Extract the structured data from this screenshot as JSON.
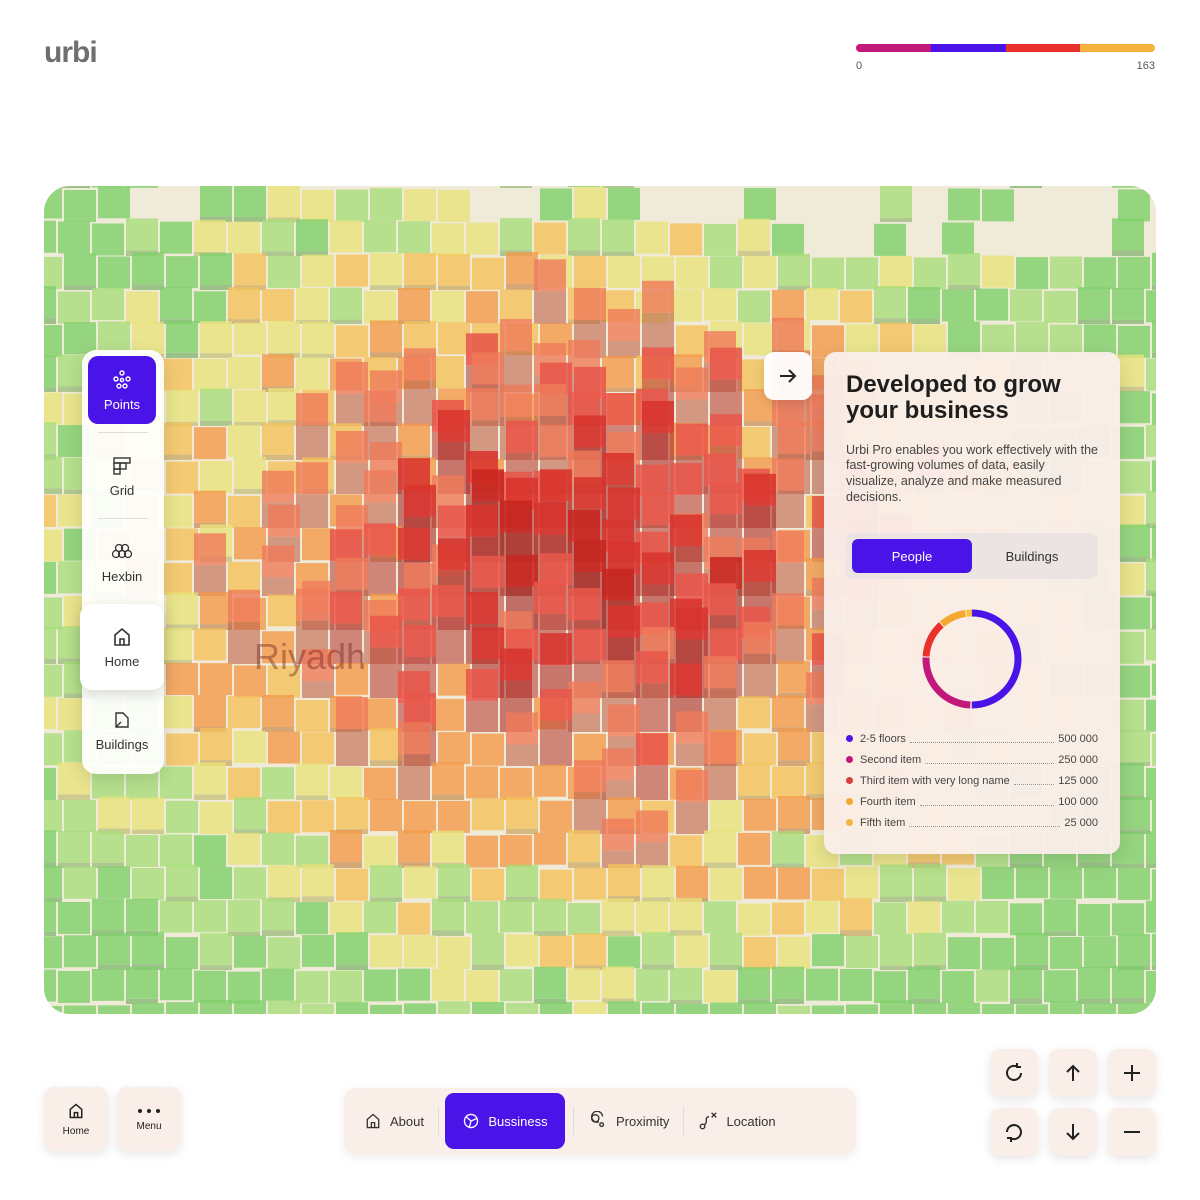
{
  "app": {
    "logo": "urbi"
  },
  "scale": {
    "min": "0",
    "max": "163",
    "colors": [
      "#c2187a",
      "#4a14e8",
      "#e8322b",
      "#f5b23e"
    ]
  },
  "map": {
    "city_label": "Riyadh"
  },
  "layers": {
    "items": [
      {
        "label": "Points",
        "icon": "points-icon",
        "active": true
      },
      {
        "label": "Grid",
        "icon": "grid-icon",
        "active": false
      },
      {
        "label": "Hexbin",
        "icon": "hexbin-icon",
        "active": false
      },
      {
        "label": "Home",
        "icon": "home-icon",
        "active": false
      },
      {
        "label": "Buildings",
        "icon": "buildings-icon",
        "active": false
      }
    ]
  },
  "info": {
    "title": "Developed to grow your business",
    "description": "Urbi Pro enables you work effectively with the fast-growing volumes of data, easily visualize, analyze and make measured decisions.",
    "tabs": [
      {
        "label": "People",
        "active": true
      },
      {
        "label": "Buildings",
        "active": false
      }
    ],
    "legend": [
      {
        "label": "2-5 floors",
        "value": "500 000",
        "color": "#4a14e8"
      },
      {
        "label": "Second item",
        "value": "250 000",
        "color": "#c2187a"
      },
      {
        "label": "Third item with very long name",
        "value": "125 000",
        "color": "#d8403a"
      },
      {
        "label": "Fourth item",
        "value": "100 000",
        "color": "#f5a830"
      },
      {
        "label": "Fifth item",
        "value": "25 000",
        "color": "#f5b23e"
      }
    ]
  },
  "bottom": {
    "home_label": "Home",
    "menu_label": "Menu",
    "nav": [
      {
        "label": "About",
        "active": false
      },
      {
        "label": "Bussiness",
        "active": true
      },
      {
        "label": "Proximity",
        "active": false
      },
      {
        "label": "Location",
        "active": false
      }
    ]
  }
}
